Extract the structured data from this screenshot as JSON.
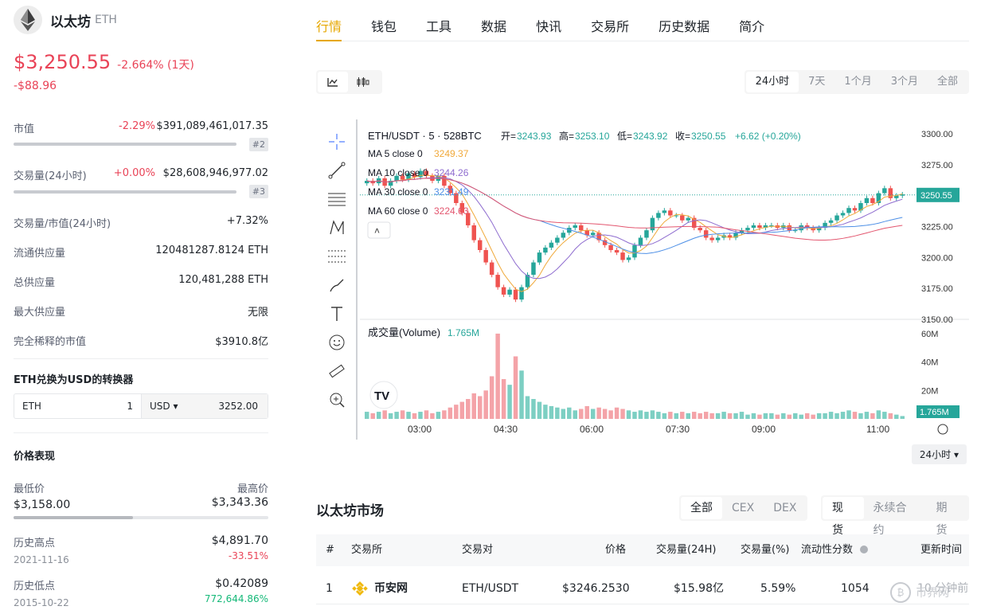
{
  "coin": {
    "name": "以太坊",
    "symbol": "ETH",
    "price": "$3,250.55",
    "change_pct": "-2.664% (1天)",
    "change_abs": "-$88.96"
  },
  "stats": {
    "market_cap": {
      "label": "市值",
      "pct": "-2.29%",
      "value": "$391,089,461,017.35",
      "rank": "#2"
    },
    "volume": {
      "label": "交易量(24小时)",
      "pct": "+0.00%",
      "value": "$28,608,946,977.02",
      "rank": "#3"
    },
    "vol_mcap": {
      "label": "交易量/市值(24小时)",
      "value": "+7.32%"
    },
    "circ_supply": {
      "label": "流通供应量",
      "value": "120481287.8124 ETH"
    },
    "total_supply": {
      "label": "总供应量",
      "value": "120,481,288 ETH"
    },
    "max_supply": {
      "label": "最大供应量",
      "value": "无限"
    },
    "fdv": {
      "label": "完全稀释的市值",
      "value": "$3910.8亿"
    }
  },
  "converter": {
    "title": "ETH兑换为USD的转换器",
    "from_sym": "ETH",
    "from_val": "1",
    "to_sym": "USD ▾",
    "to_val": "3252.00"
  },
  "performance": {
    "title": "价格表现",
    "period": "24小时 ▾",
    "low_label": "最低价",
    "low": "$3,158.00",
    "high_label": "最高价",
    "high": "$3,343.36",
    "range_fill_fraction": 0.47,
    "ath_label": "历史高点",
    "ath_date": "2021-11-16",
    "ath": "$4,891.70",
    "ath_pct": "-33.51%",
    "atl_label": "历史低点",
    "atl_date": "2015-10-22",
    "atl": "$0.42089",
    "atl_pct": "772,644.86%"
  },
  "tabs": [
    "行情",
    "钱包",
    "工具",
    "数据",
    "快讯",
    "交易所",
    "历史数据",
    "简介"
  ],
  "chart_toolbar": {
    "periods": [
      "24小时",
      "7天",
      "1个月",
      "3个月",
      "全部"
    ],
    "selected": "24小时"
  },
  "chart_data": {
    "type": "candlestick",
    "title": "ETH/USDT · 5 · 528BTC",
    "ohlc_label": {
      "o_label": "开=",
      "o": "3243.93",
      "h_label": "高=",
      "h": "3253.10",
      "l_label": "低=",
      "l": "3243.92",
      "c_label": "收=",
      "c": "3250.55",
      "chg": "+6.62 (+0.20%)"
    },
    "ma": [
      {
        "name": "MA 5 close 0",
        "value": "3249.37",
        "color": "#f0a93a"
      },
      {
        "name": "MA 10 close 0",
        "value": "3244.26",
        "color": "#8e6ccf"
      },
      {
        "name": "MA 30 close 0",
        "value": "3231.49",
        "color": "#4d8fe6"
      },
      {
        "name": "MA 60 close 0",
        "value": "3224.63",
        "color": "#e3566f"
      }
    ],
    "y_ticks": [
      "3300.00",
      "3275.00",
      "3250.00",
      "3225.00",
      "3200.00",
      "3175.00",
      "3150.00"
    ],
    "ylim": [
      3150,
      3300
    ],
    "last_price": "3250.55",
    "x_ticks": [
      "03:00",
      "04:30",
      "06:00",
      "07:30",
      "09:00",
      "11:00"
    ],
    "volume_label": "成交量(Volume)",
    "volume_value": "1.765M",
    "volume_ticks": [
      "60M",
      "40M",
      "20M"
    ],
    "volume_last": "1.765M",
    "closes": [
      3262,
      3260,
      3264,
      3258,
      3262,
      3266,
      3263,
      3268,
      3265,
      3270,
      3266,
      3262,
      3266,
      3258,
      3252,
      3244,
      3236,
      3226,
      3214,
      3206,
      3196,
      3186,
      3176,
      3170,
      3174,
      3166,
      3176,
      3186,
      3196,
      3204,
      3208,
      3212,
      3216,
      3220,
      3224,
      3226,
      3222,
      3218,
      3220,
      3214,
      3210,
      3206,
      3204,
      3198,
      3200,
      3210,
      3216,
      3222,
      3232,
      3236,
      3238,
      3234,
      3234,
      3230,
      3232,
      3224,
      3222,
      3216,
      3214,
      3216,
      3218,
      3216,
      3220,
      3222,
      3224,
      3226,
      3224,
      3226,
      3226,
      3224,
      3226,
      3222,
      3222,
      3226,
      3224,
      3222,
      3224,
      3228,
      3230,
      3234,
      3236,
      3240,
      3238,
      3244,
      3248,
      3244,
      3252,
      3256,
      3248,
      3250,
      3251
    ],
    "volumes": [
      5,
      4,
      5,
      6,
      4,
      5,
      6,
      5,
      4,
      5,
      6,
      4,
      5,
      6,
      8,
      10,
      12,
      14,
      18,
      16,
      20,
      30,
      60,
      28,
      24,
      44,
      34,
      16,
      14,
      12,
      10,
      9,
      8,
      7,
      8,
      6,
      7,
      9,
      7,
      8,
      7,
      6,
      8,
      7,
      6,
      5,
      6,
      5,
      6,
      5,
      4,
      5,
      4,
      5,
      4,
      5,
      4,
      5,
      4,
      4,
      5,
      4,
      4,
      5,
      3,
      4,
      3,
      4,
      4,
      3,
      4,
      3,
      4,
      3,
      4,
      3,
      4,
      4,
      5,
      4,
      5,
      6,
      5,
      4,
      5,
      4,
      6,
      5,
      4,
      3,
      2
    ]
  },
  "market": {
    "title": "以太坊市场",
    "filters": [
      "全部",
      "CEX",
      "DEX"
    ],
    "types": [
      "现货",
      "永续合约",
      "期货"
    ],
    "columns": [
      "#",
      "交易所",
      "交易对",
      "价格",
      "交易量(24H)",
      "交易量(%)",
      "流动性分数",
      "更新时间"
    ],
    "rows": [
      {
        "rank": "1",
        "exchange": "币安网",
        "pair": "ETH/USDT",
        "price": "$3246.2530",
        "volume": "$15.98亿",
        "vol_pct": "5.59%",
        "liquidity": "1054",
        "updated": "10 分钟前"
      }
    ]
  },
  "watermark": "币界网"
}
